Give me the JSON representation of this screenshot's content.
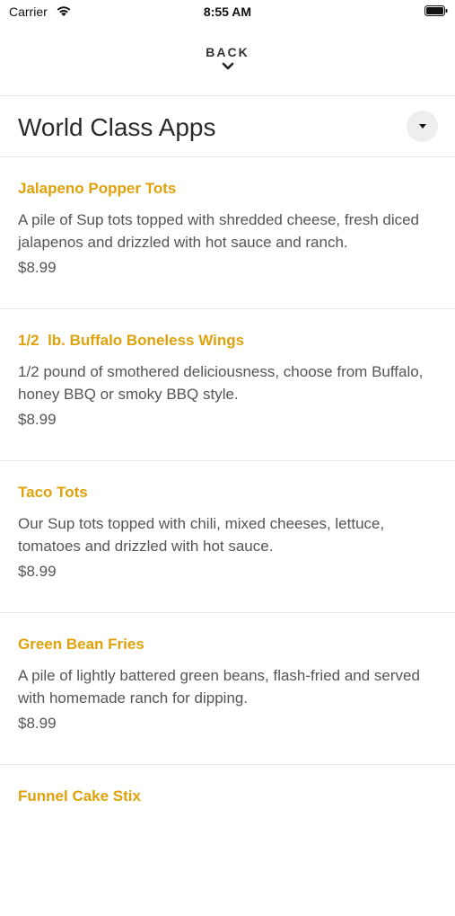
{
  "status_bar": {
    "carrier": "Carrier",
    "time": "8:55 AM"
  },
  "nav": {
    "back_label": "BACK"
  },
  "section": {
    "title": "World Class Apps"
  },
  "colors": {
    "accent": "#e0a20b",
    "text": "#555555",
    "divider": "#e6e6e6"
  },
  "icons": {
    "wifi": "wifi-icon",
    "battery": "battery-icon",
    "back": "chevron-down-icon",
    "dropdown": "dropdown-triangle-icon"
  },
  "items": [
    {
      "name": "Jalapeno Popper Tots",
      "description": "A pile of Sup tots topped with shredded cheese, fresh diced jalapenos and drizzled with hot sauce and ranch.",
      "price": "$8.99"
    },
    {
      "name": "1/2  lb. Buffalo Boneless Wings",
      "description": "1/2 pound of smothered deliciousness, choose from Buffalo, honey BBQ or smoky BBQ style.",
      "price": "$8.99"
    },
    {
      "name": "Taco Tots",
      "description": "Our Sup tots topped with chili, mixed cheeses, lettuce, tomatoes and drizzled with hot sauce.",
      "price": "$8.99"
    },
    {
      "name": "Green Bean Fries",
      "description": "A pile of lightly battered green beans, flash-fried and served with homemade ranch for dipping.",
      "price": "$8.99"
    },
    {
      "name": "Funnel Cake Stix",
      "description": "",
      "price": ""
    }
  ]
}
